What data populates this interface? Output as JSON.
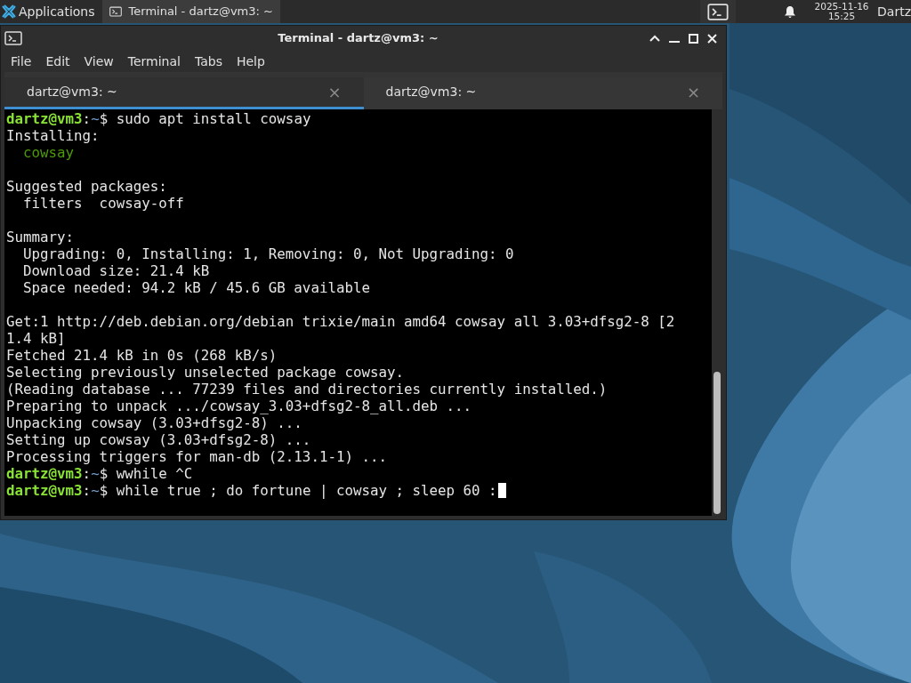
{
  "panel": {
    "applications": "Applications",
    "tasks": [
      {
        "label": "Terminal - dartz@vm3: ~",
        "selected": true
      }
    ],
    "date": "2025-11-16",
    "time": "15:25",
    "user": "Dartz"
  },
  "window": {
    "title": "Terminal - dartz@vm3: ~",
    "menu": [
      "File",
      "Edit",
      "View",
      "Terminal",
      "Tabs",
      "Help"
    ],
    "tabs": [
      {
        "label": "dartz@vm3: ~",
        "close": "×",
        "selected": true
      },
      {
        "label": "dartz@vm3: ~",
        "close": "×",
        "selected": false
      }
    ],
    "lines": [
      {
        "kind": "prompt",
        "user": "dartz@vm3",
        "sep": ":",
        "path": "~",
        "symbol": "$",
        "command": "sudo apt install cowsay",
        "cursor": false
      },
      {
        "kind": "text",
        "text": "Installing:"
      },
      {
        "kind": "green",
        "text": "  cowsay"
      },
      {
        "kind": "blank"
      },
      {
        "kind": "text",
        "text": "Suggested packages:"
      },
      {
        "kind": "text",
        "text": "  filters  cowsay-off"
      },
      {
        "kind": "blank"
      },
      {
        "kind": "text",
        "text": "Summary:"
      },
      {
        "kind": "text",
        "text": "  Upgrading: 0, Installing: 1, Removing: 0, Not Upgrading: 0"
      },
      {
        "kind": "text",
        "text": "  Download size: 21.4 kB"
      },
      {
        "kind": "text",
        "text": "  Space needed: 94.2 kB / 45.6 GB available"
      },
      {
        "kind": "blank"
      },
      {
        "kind": "text",
        "text": "Get:1 http://deb.debian.org/debian trixie/main amd64 cowsay all 3.03+dfsg2-8 [2"
      },
      {
        "kind": "text",
        "text": "1.4 kB]"
      },
      {
        "kind": "text",
        "text": "Fetched 21.4 kB in 0s (268 kB/s)"
      },
      {
        "kind": "text",
        "text": "Selecting previously unselected package cowsay."
      },
      {
        "kind": "text",
        "text": "(Reading database ... 77239 files and directories currently installed.)"
      },
      {
        "kind": "text",
        "text": "Preparing to unpack .../cowsay_3.03+dfsg2-8_all.deb ..."
      },
      {
        "kind": "text",
        "text": "Unpacking cowsay (3.03+dfsg2-8) ..."
      },
      {
        "kind": "text",
        "text": "Setting up cowsay (3.03+dfsg2-8) ..."
      },
      {
        "kind": "text",
        "text": "Processing triggers for man-db (2.13.1-1) ..."
      },
      {
        "kind": "prompt",
        "user": "dartz@vm3",
        "sep": ":",
        "path": "~",
        "symbol": "$",
        "command": "wwhile ^C",
        "cursor": false
      },
      {
        "kind": "prompt",
        "user": "dartz@vm3",
        "sep": ":",
        "path": "~",
        "symbol": "$",
        "command": "while true ; do fortune | cowsay ; sleep 60 :",
        "cursor": true
      }
    ]
  }
}
